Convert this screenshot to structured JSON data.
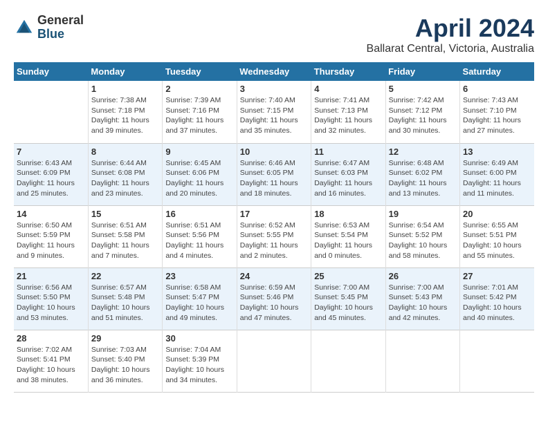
{
  "header": {
    "logo_line1": "General",
    "logo_line2": "Blue",
    "title": "April 2024",
    "location": "Ballarat Central, Victoria, Australia"
  },
  "calendar": {
    "weekdays": [
      "Sunday",
      "Monday",
      "Tuesday",
      "Wednesday",
      "Thursday",
      "Friday",
      "Saturday"
    ],
    "weeks": [
      [
        {
          "day": "",
          "info": ""
        },
        {
          "day": "1",
          "info": "Sunrise: 7:38 AM\nSunset: 7:18 PM\nDaylight: 11 hours\nand 39 minutes."
        },
        {
          "day": "2",
          "info": "Sunrise: 7:39 AM\nSunset: 7:16 PM\nDaylight: 11 hours\nand 37 minutes."
        },
        {
          "day": "3",
          "info": "Sunrise: 7:40 AM\nSunset: 7:15 PM\nDaylight: 11 hours\nand 35 minutes."
        },
        {
          "day": "4",
          "info": "Sunrise: 7:41 AM\nSunset: 7:13 PM\nDaylight: 11 hours\nand 32 minutes."
        },
        {
          "day": "5",
          "info": "Sunrise: 7:42 AM\nSunset: 7:12 PM\nDaylight: 11 hours\nand 30 minutes."
        },
        {
          "day": "6",
          "info": "Sunrise: 7:43 AM\nSunset: 7:10 PM\nDaylight: 11 hours\nand 27 minutes."
        }
      ],
      [
        {
          "day": "7",
          "info": "Sunrise: 6:43 AM\nSunset: 6:09 PM\nDaylight: 11 hours\nand 25 minutes."
        },
        {
          "day": "8",
          "info": "Sunrise: 6:44 AM\nSunset: 6:08 PM\nDaylight: 11 hours\nand 23 minutes."
        },
        {
          "day": "9",
          "info": "Sunrise: 6:45 AM\nSunset: 6:06 PM\nDaylight: 11 hours\nand 20 minutes."
        },
        {
          "day": "10",
          "info": "Sunrise: 6:46 AM\nSunset: 6:05 PM\nDaylight: 11 hours\nand 18 minutes."
        },
        {
          "day": "11",
          "info": "Sunrise: 6:47 AM\nSunset: 6:03 PM\nDaylight: 11 hours\nand 16 minutes."
        },
        {
          "day": "12",
          "info": "Sunrise: 6:48 AM\nSunset: 6:02 PM\nDaylight: 11 hours\nand 13 minutes."
        },
        {
          "day": "13",
          "info": "Sunrise: 6:49 AM\nSunset: 6:00 PM\nDaylight: 11 hours\nand 11 minutes."
        }
      ],
      [
        {
          "day": "14",
          "info": "Sunrise: 6:50 AM\nSunset: 5:59 PM\nDaylight: 11 hours\nand 9 minutes."
        },
        {
          "day": "15",
          "info": "Sunrise: 6:51 AM\nSunset: 5:58 PM\nDaylight: 11 hours\nand 7 minutes."
        },
        {
          "day": "16",
          "info": "Sunrise: 6:51 AM\nSunset: 5:56 PM\nDaylight: 11 hours\nand 4 minutes."
        },
        {
          "day": "17",
          "info": "Sunrise: 6:52 AM\nSunset: 5:55 PM\nDaylight: 11 hours\nand 2 minutes."
        },
        {
          "day": "18",
          "info": "Sunrise: 6:53 AM\nSunset: 5:54 PM\nDaylight: 11 hours\nand 0 minutes."
        },
        {
          "day": "19",
          "info": "Sunrise: 6:54 AM\nSunset: 5:52 PM\nDaylight: 10 hours\nand 58 minutes."
        },
        {
          "day": "20",
          "info": "Sunrise: 6:55 AM\nSunset: 5:51 PM\nDaylight: 10 hours\nand 55 minutes."
        }
      ],
      [
        {
          "day": "21",
          "info": "Sunrise: 6:56 AM\nSunset: 5:50 PM\nDaylight: 10 hours\nand 53 minutes."
        },
        {
          "day": "22",
          "info": "Sunrise: 6:57 AM\nSunset: 5:48 PM\nDaylight: 10 hours\nand 51 minutes."
        },
        {
          "day": "23",
          "info": "Sunrise: 6:58 AM\nSunset: 5:47 PM\nDaylight: 10 hours\nand 49 minutes."
        },
        {
          "day": "24",
          "info": "Sunrise: 6:59 AM\nSunset: 5:46 PM\nDaylight: 10 hours\nand 47 minutes."
        },
        {
          "day": "25",
          "info": "Sunrise: 7:00 AM\nSunset: 5:45 PM\nDaylight: 10 hours\nand 45 minutes."
        },
        {
          "day": "26",
          "info": "Sunrise: 7:00 AM\nSunset: 5:43 PM\nDaylight: 10 hours\nand 42 minutes."
        },
        {
          "day": "27",
          "info": "Sunrise: 7:01 AM\nSunset: 5:42 PM\nDaylight: 10 hours\nand 40 minutes."
        }
      ],
      [
        {
          "day": "28",
          "info": "Sunrise: 7:02 AM\nSunset: 5:41 PM\nDaylight: 10 hours\nand 38 minutes."
        },
        {
          "day": "29",
          "info": "Sunrise: 7:03 AM\nSunset: 5:40 PM\nDaylight: 10 hours\nand 36 minutes."
        },
        {
          "day": "30",
          "info": "Sunrise: 7:04 AM\nSunset: 5:39 PM\nDaylight: 10 hours\nand 34 minutes."
        },
        {
          "day": "",
          "info": ""
        },
        {
          "day": "",
          "info": ""
        },
        {
          "day": "",
          "info": ""
        },
        {
          "day": "",
          "info": ""
        }
      ]
    ]
  }
}
